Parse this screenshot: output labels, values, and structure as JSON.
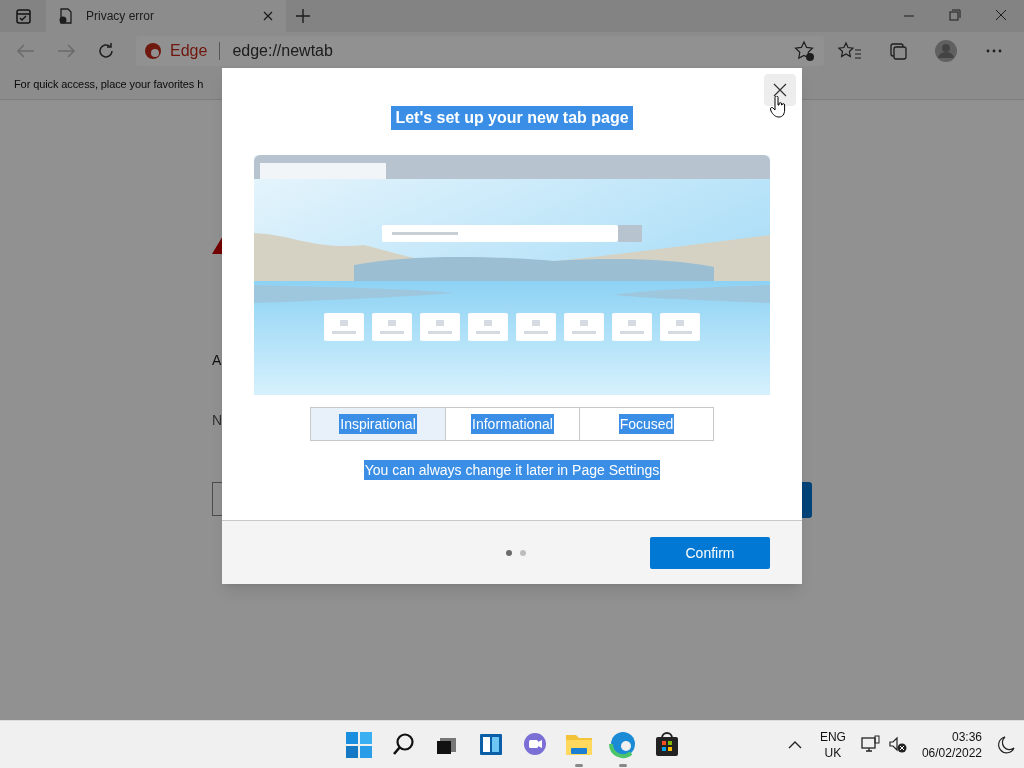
{
  "browser": {
    "tabs": [
      {
        "title": "Privacy error"
      }
    ],
    "address": {
      "site_label": "Edge",
      "url": "edge://newtab"
    },
    "favorites_hint": "For quick access, place your favorites h"
  },
  "error_page": {
    "fragments": [
      "A",
      "N"
    ]
  },
  "dialog": {
    "title": "Let's set up your new tab page",
    "text_highlighted": true,
    "layouts": [
      {
        "label": "Inspirational",
        "selected": true
      },
      {
        "label": "Informational",
        "selected": false
      },
      {
        "label": "Focused",
        "selected": false
      }
    ],
    "hint": "You can always change it later in Page Settings",
    "pages": [
      {
        "selected": true
      },
      {
        "selected": false
      }
    ],
    "confirm": "Confirm"
  },
  "taskbar": {
    "apps": [
      {
        "kind": "start",
        "running": false
      },
      {
        "kind": "search",
        "running": false
      },
      {
        "kind": "taskview",
        "running": false
      },
      {
        "kind": "widgets",
        "running": false
      },
      {
        "kind": "chat",
        "running": false
      },
      {
        "kind": "explorer",
        "running": true
      },
      {
        "kind": "edge",
        "running": true
      },
      {
        "kind": "store",
        "running": false
      }
    ],
    "language": [
      "ENG",
      "UK"
    ],
    "time": "03:36",
    "date": "06/02/2022"
  }
}
